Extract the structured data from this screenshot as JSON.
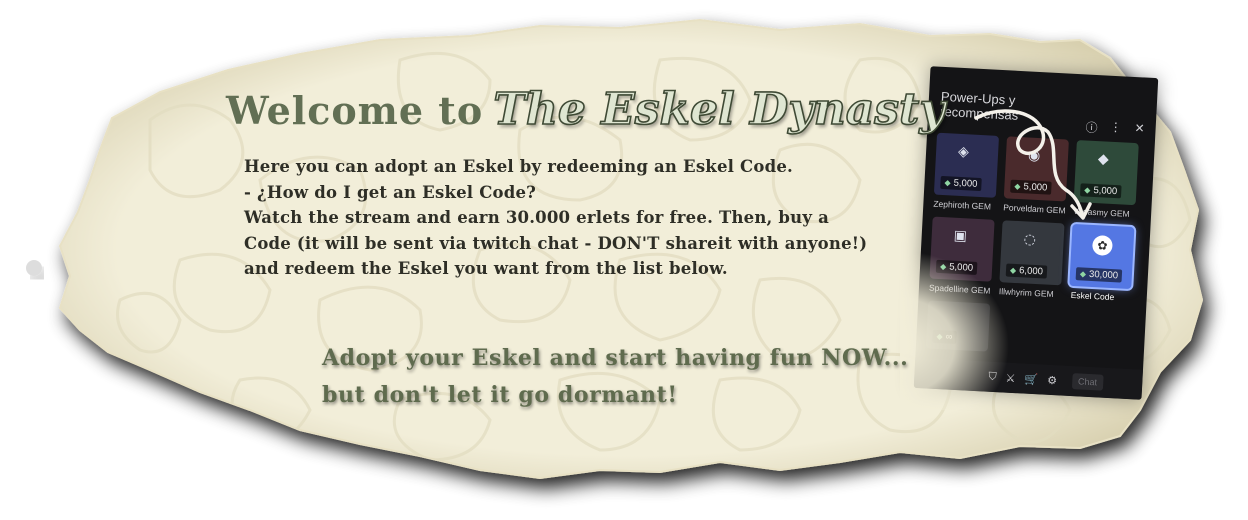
{
  "welcome": {
    "lead": "Welcome to",
    "brand": "The Eskel Dynasty"
  },
  "intro_lines": [
    "Here you can adopt an Eskel by redeeming an Eskel Code.",
    "- ¿How do I get an Eskel Code?",
    "Watch the stream and earn 30.000 erlets for free. Then, buy a",
    "Code (it will be sent via twitch chat - DON'T shareit with anyone!)",
    "and redeem the Eskel you want from the list below."
  ],
  "cta_lines": [
    "Adopt your Eskel and start having fun NOW...",
    "but don't let it go dormant!"
  ],
  "rewards_panel": {
    "title": "Power-Ups y recompensas",
    "header_icons": [
      "info-icon",
      "more-icon",
      "close-icon"
    ],
    "header_glyphs": [
      "ⓘ",
      "⋮",
      "✕"
    ],
    "rewards": [
      {
        "name": "Zephiroth GEM",
        "cost": "5,000",
        "color": "#2b2d52",
        "emblem": "◈"
      },
      {
        "name": "Porveldam GEM",
        "cost": "5,000",
        "color": "#4a2a2c",
        "emblem": "◉"
      },
      {
        "name": "Vadasmy GEM",
        "cost": "5,000",
        "color": "#2e4a3a",
        "emblem": "◆"
      },
      {
        "name": "Spadelline GEM",
        "cost": "5,000",
        "color": "#3e2c3c",
        "emblem": "▣"
      },
      {
        "name": "Illwhyrim GEM",
        "cost": "6,000",
        "color": "#34383e",
        "emblem": "◌"
      },
      {
        "name": "Eskel Code",
        "cost": "30,000",
        "color": "#5477e3",
        "emblem": "✿"
      }
    ],
    "partial_cost": "∞",
    "bottom_icons": [
      "shield-icon",
      "sword-icon",
      "cart-icon",
      "settings-icon"
    ],
    "bottom_glyphs": [
      "⛉",
      "⚔",
      "🛒",
      "⚙"
    ],
    "chat_label": "Chat"
  },
  "colors": {
    "parchment": "#f2eed9",
    "stone_line": "#dcd6b8",
    "sage_title": "#626f54",
    "ink": "#2e2e26",
    "highlight_blue": "#5477e3"
  }
}
